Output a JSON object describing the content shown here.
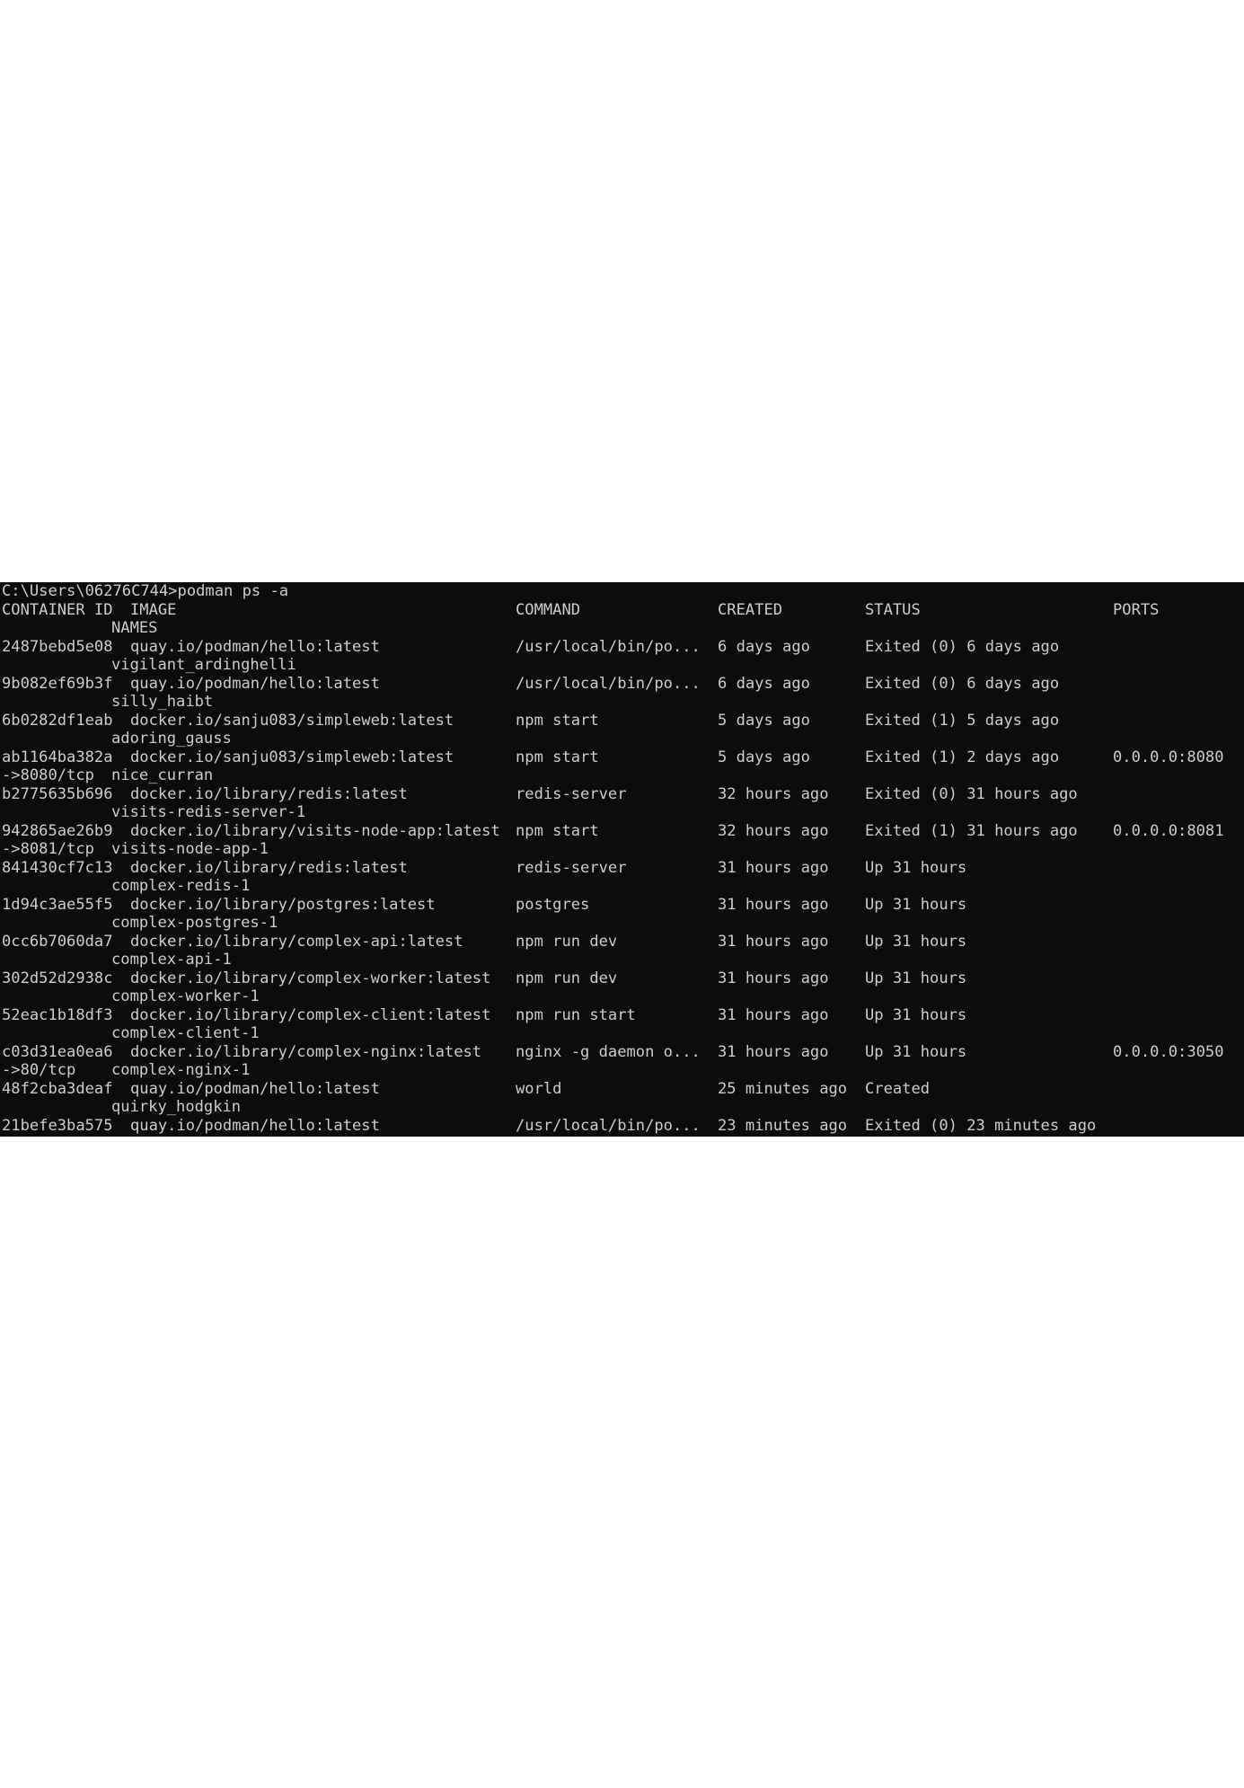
{
  "terminal": {
    "prompt": "C:\\Users\\06276C744>podman ps -a",
    "headers": {
      "container_id": "CONTAINER ID",
      "image": "IMAGE",
      "command": "COMMAND",
      "created": "CREATED",
      "status": "STATUS",
      "ports": "PORTS",
      "names": "NAMES"
    },
    "rows": [
      {
        "id": "2487bebd5e08",
        "image": "quay.io/podman/hello:latest",
        "command": "/usr/local/bin/po...",
        "created": "6 days ago",
        "status": "Exited (0) 6 days ago",
        "ports": "",
        "wrap": "",
        "names": "vigilant_ardinghelli"
      },
      {
        "id": "9b082ef69b3f",
        "image": "quay.io/podman/hello:latest",
        "command": "/usr/local/bin/po...",
        "created": "6 days ago",
        "status": "Exited (0) 6 days ago",
        "ports": "",
        "wrap": "",
        "names": "silly_haibt"
      },
      {
        "id": "6b0282df1eab",
        "image": "docker.io/sanju083/simpleweb:latest",
        "command": "npm start",
        "created": "5 days ago",
        "status": "Exited (1) 5 days ago",
        "ports": "",
        "wrap": "",
        "names": "adoring_gauss"
      },
      {
        "id": "ab1164ba382a",
        "image": "docker.io/sanju083/simpleweb:latest",
        "command": "npm start",
        "created": "5 days ago",
        "status": "Exited (1) 2 days ago",
        "ports": "0.0.0.0:8080",
        "wrap": "->8080/tcp",
        "names": "nice_curran"
      },
      {
        "id": "b2775635b696",
        "image": "docker.io/library/redis:latest",
        "command": "redis-server",
        "created": "32 hours ago",
        "status": "Exited (0) 31 hours ago",
        "ports": "",
        "wrap": "",
        "names": "visits-redis-server-1"
      },
      {
        "id": "942865ae26b9",
        "image": "docker.io/library/visits-node-app:latest",
        "command": "npm start",
        "created": "32 hours ago",
        "status": "Exited (1) 31 hours ago",
        "ports": "0.0.0.0:8081",
        "wrap": "->8081/tcp",
        "names": "visits-node-app-1"
      },
      {
        "id": "841430cf7c13",
        "image": "docker.io/library/redis:latest",
        "command": "redis-server",
        "created": "31 hours ago",
        "status": "Up 31 hours",
        "ports": "",
        "wrap": "",
        "names": "complex-redis-1"
      },
      {
        "id": "1d94c3ae55f5",
        "image": "docker.io/library/postgres:latest",
        "command": "postgres",
        "created": "31 hours ago",
        "status": "Up 31 hours",
        "ports": "",
        "wrap": "",
        "names": "complex-postgres-1"
      },
      {
        "id": "0cc6b7060da7",
        "image": "docker.io/library/complex-api:latest",
        "command": "npm run dev",
        "created": "31 hours ago",
        "status": "Up 31 hours",
        "ports": "",
        "wrap": "",
        "names": "complex-api-1"
      },
      {
        "id": "302d52d2938c",
        "image": "docker.io/library/complex-worker:latest",
        "command": "npm run dev",
        "created": "31 hours ago",
        "status": "Up 31 hours",
        "ports": "",
        "wrap": "",
        "names": "complex-worker-1"
      },
      {
        "id": "52eac1b18df3",
        "image": "docker.io/library/complex-client:latest",
        "command": "npm run start",
        "created": "31 hours ago",
        "status": "Up 31 hours",
        "ports": "",
        "wrap": "",
        "names": "complex-client-1"
      },
      {
        "id": "c03d31ea0ea6",
        "image": "docker.io/library/complex-nginx:latest",
        "command": "nginx -g daemon o...",
        "created": "31 hours ago",
        "status": "Up 31 hours",
        "ports": "0.0.0.0:3050",
        "wrap": "->80/tcp",
        "names": "complex-nginx-1"
      },
      {
        "id": "48f2cba3deaf",
        "image": "quay.io/podman/hello:latest",
        "command": "world",
        "created": "25 minutes ago",
        "status": "Created",
        "ports": "",
        "wrap": "",
        "names": "quirky_hodgkin"
      },
      {
        "id": "21befe3ba575",
        "image": "quay.io/podman/hello:latest",
        "command": "/usr/local/bin/po...",
        "created": "23 minutes ago",
        "status": "Exited (0) 23 minutes ago",
        "ports": "",
        "wrap": "",
        "names": ""
      }
    ]
  }
}
